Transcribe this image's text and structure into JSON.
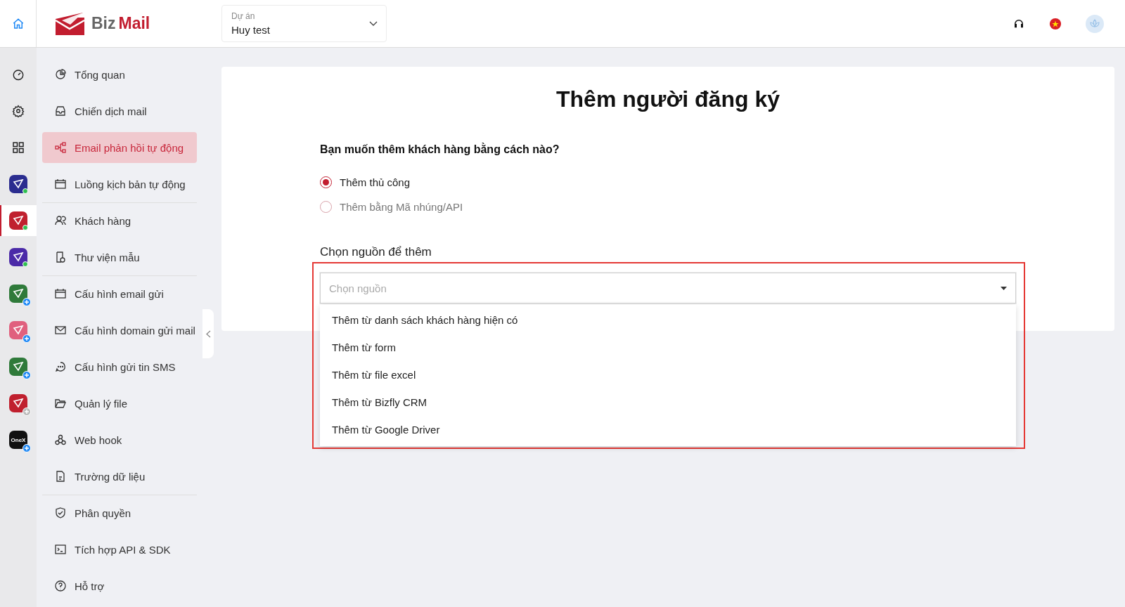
{
  "header": {
    "logo": {
      "part_1": "Biz",
      "part_2": "Mail"
    },
    "project": {
      "label": "Dự án",
      "value": "Huy test"
    }
  },
  "rail": {
    "apps": [
      {
        "color": "#2b2d8f",
        "kind": "online",
        "selected": false
      },
      {
        "color": "#c0202e",
        "kind": "online",
        "selected": true
      },
      {
        "color": "#4b2aa8",
        "kind": "online",
        "selected": false
      },
      {
        "color": "#2f7a3a",
        "kind": "add",
        "selected": false
      },
      {
        "color": "#e0607e",
        "kind": "add",
        "selected": false
      },
      {
        "color": "#2f7a3a",
        "kind": "add",
        "selected": false
      },
      {
        "color": "#c0202e",
        "kind": "add_disabled",
        "selected": false
      },
      {
        "color": "#111111",
        "kind": "add",
        "selected": false,
        "label": "OneX"
      }
    ]
  },
  "sidebar": {
    "groups": [
      [
        {
          "label": "Tổng quan",
          "selected": false
        },
        {
          "label": "Chiến dịch mail",
          "selected": false
        },
        {
          "label": "Email phản hồi tự động",
          "selected": true
        },
        {
          "label": "Luồng kịch bản tự động",
          "selected": false
        }
      ],
      [
        {
          "label": "Khách hàng",
          "selected": false
        },
        {
          "label": "Thư viện mẫu",
          "selected": false
        }
      ],
      [
        {
          "label": "Cấu hình email gửi",
          "selected": false
        },
        {
          "label": "Cấu hình domain gửi mail",
          "selected": false
        },
        {
          "label": "Cấu hình gửi tin SMS",
          "selected": false
        },
        {
          "label": "Quản lý file",
          "selected": false
        },
        {
          "label": "Web hook",
          "selected": false
        },
        {
          "label": "Trường dữ liệu",
          "selected": false
        }
      ],
      [
        {
          "label": "Phân quyền",
          "selected": false
        },
        {
          "label": "Tích hợp API & SDK",
          "selected": false
        },
        {
          "label": "Hỗ trợ",
          "selected": false
        }
      ]
    ]
  },
  "page": {
    "title": "Thêm người đăng ký",
    "question": "Bạn muốn thêm khách hàng bằng cách nào?",
    "methods": [
      {
        "label": "Thêm thủ công",
        "selected": true
      },
      {
        "label": "Thêm bằng Mã nhúng/API",
        "selected": false
      }
    ],
    "source": {
      "label": "Chọn nguồn để thêm",
      "placeholder": "Chọn nguồn",
      "expanded": true,
      "options": [
        "Thêm từ danh sách khách hàng hiện có",
        "Thêm từ form",
        "Thêm từ file excel",
        "Thêm từ Bizfly CRM",
        "Thêm từ Google Driver"
      ]
    }
  }
}
